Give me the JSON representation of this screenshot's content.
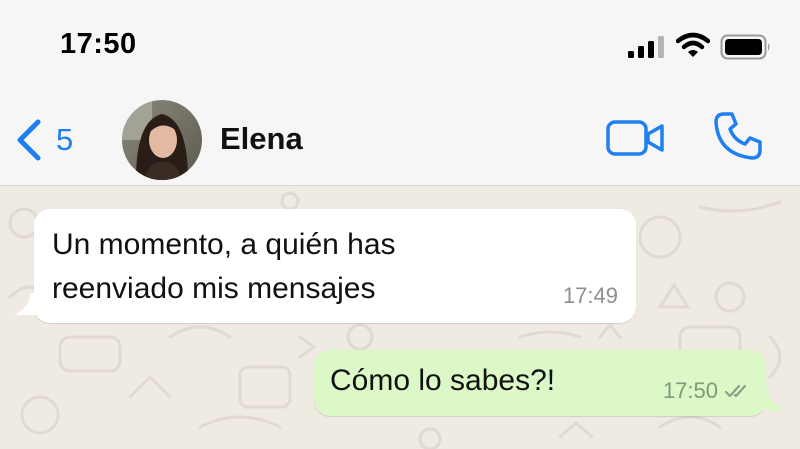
{
  "status_bar": {
    "time": "17:50"
  },
  "header": {
    "back_count": "5",
    "contact_name": "Elena",
    "accent_color": "#1d7ff0"
  },
  "messages": [
    {
      "direction": "incoming",
      "text": "Un momento, a quién has reenviado mis mensajes",
      "time": "17:49"
    },
    {
      "direction": "outgoing",
      "text": "Cómo lo sabes?!",
      "time": "17:50",
      "status": "read-double-check"
    }
  ],
  "colors": {
    "incoming_bubble": "#ffffff",
    "outgoing_bubble": "#dcf8c6",
    "chat_background": "#efeae2"
  },
  "icons": [
    "signal-icon",
    "wifi-icon",
    "battery-icon",
    "back-chevron-icon",
    "video-call-icon",
    "phone-call-icon",
    "double-check-icon"
  ]
}
